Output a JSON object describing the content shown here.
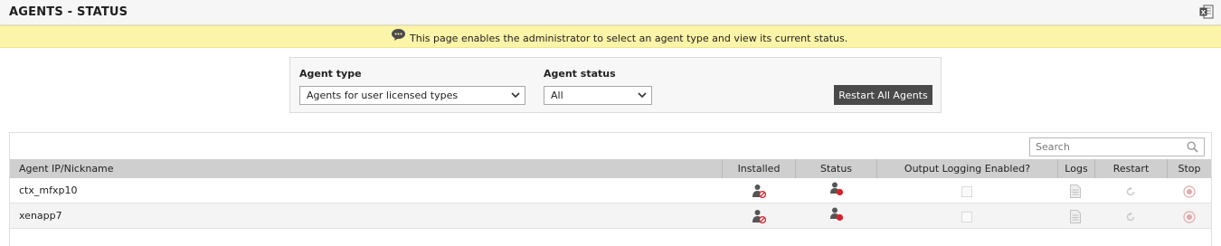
{
  "page": {
    "title": "AGENTS - STATUS",
    "export_icon": "excel-export-icon"
  },
  "info": {
    "icon": "speech-bubble-icon",
    "message": "This page enables the administrator to select an agent type and view its current status."
  },
  "filters": {
    "agent_type_label": "Agent type",
    "agent_type_value": "Agents for user licensed types",
    "agent_status_label": "Agent status",
    "agent_status_value": "All",
    "restart_all_label": "Restart All Agents"
  },
  "grid": {
    "search_placeholder": "Search",
    "columns": [
      "Agent IP/Nickname",
      "Installed",
      "Status",
      "Output Logging Enabled?",
      "Logs",
      "Restart",
      "Stop"
    ],
    "rows": [
      {
        "name": "ctx_mfxp10",
        "installed_icon": "agent-not-installed-icon",
        "status_icon": "agent-offline-icon",
        "logging_enabled": false,
        "logs_icon": "log-file-icon",
        "restart_icon": "restart-icon",
        "stop_icon": "stop-icon"
      },
      {
        "name": "xenapp7",
        "installed_icon": "agent-not-installed-icon",
        "status_icon": "agent-offline-icon",
        "logging_enabled": false,
        "logs_icon": "log-file-icon",
        "restart_icon": "restart-icon",
        "stop_icon": "stop-icon"
      }
    ]
  },
  "colors": {
    "info_bar": "#fcf4a8",
    "header": "#cfcfcf",
    "button": "#4a4a4a",
    "status_red": "#d9212a"
  }
}
